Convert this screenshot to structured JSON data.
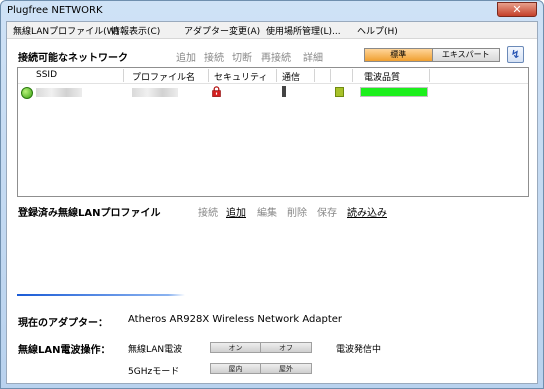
{
  "window": {
    "title": "Plugfree NETWORK",
    "close_label": "✕"
  },
  "menu": [
    "無線LANプロファイル(W)",
    "情報表示(C)",
    "アダプター変更(A)",
    "使用場所管理(L)...",
    "ヘルプ(H)"
  ],
  "networks": {
    "title": "接続可能なネットワーク",
    "actions": [
      "追加",
      "接続",
      "切断",
      "再接続",
      "詳細"
    ],
    "modes": {
      "standard": "標準",
      "expert": "エキスパート"
    },
    "columns": [
      "SSID",
      "プロファイル名",
      "セキュリティ",
      "通信",
      "電波品質"
    ],
    "rows": [
      {
        "ssid": "",
        "profile": "",
        "signal_quality_fraction": 1.0
      }
    ]
  },
  "profiles": {
    "title": "登録済み無線LANプロファイル",
    "actions": [
      {
        "label": "接続",
        "enabled": false
      },
      {
        "label": "追加",
        "enabled": true
      },
      {
        "label": "編集",
        "enabled": false
      },
      {
        "label": "削除",
        "enabled": false
      },
      {
        "label": "保存",
        "enabled": false
      },
      {
        "label": "読み込み",
        "enabled": true
      }
    ]
  },
  "adapter": {
    "label": "現在のアダプター：",
    "value": "Atheros AR928X Wireless Network Adapter"
  },
  "radio": {
    "label": "無線LAN電波操作：",
    "wlan_label": "無線LAN電波",
    "on": "オン",
    "off": "オフ",
    "status": "電波発信中",
    "mode_label": "5GHzモード",
    "indoor": "屋内",
    "outdoor": "屋外"
  },
  "colors": {
    "quality_bar": "#1cef1c",
    "mode_active": "#f0a030",
    "accent_line": "#1a5bd6"
  }
}
